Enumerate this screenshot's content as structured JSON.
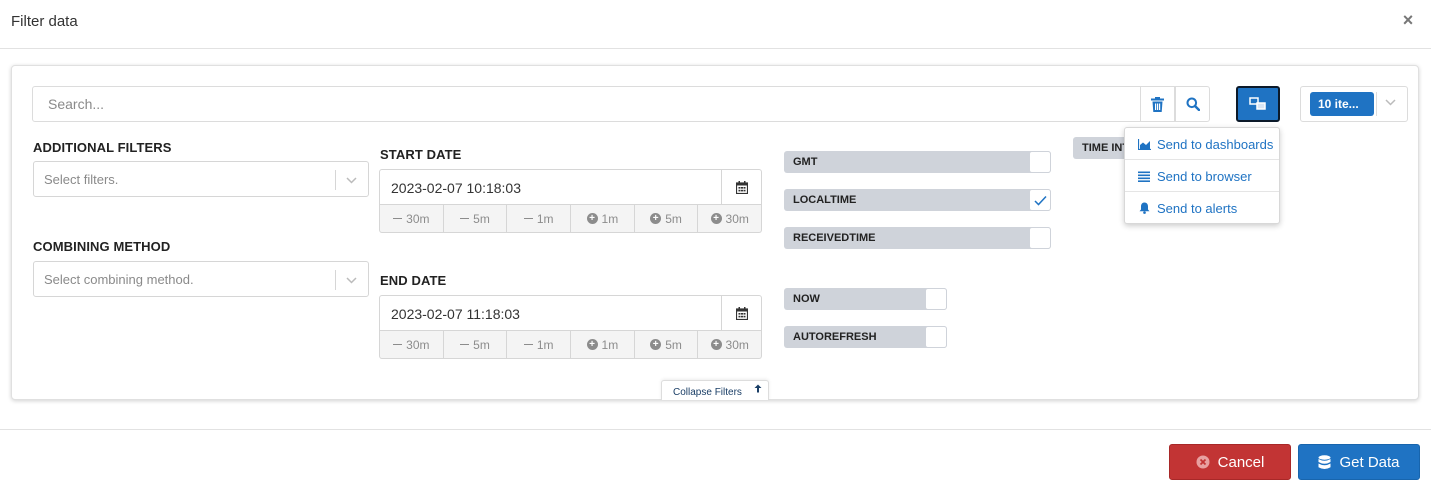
{
  "modal": {
    "title": "Filter data",
    "close_label": "×"
  },
  "search": {
    "placeholder": "Search..."
  },
  "items_select": {
    "value": "10 ite..."
  },
  "additional_filters": {
    "label": "ADDITIONAL FILTERS",
    "placeholder": "Select filters."
  },
  "combining_method": {
    "label": "COMBINING METHOD",
    "placeholder": "Select combining method."
  },
  "start_date": {
    "label": "START DATE",
    "value": "2023-02-07 10:18:03",
    "offsets": [
      "30m",
      "5m",
      "1m",
      "1m",
      "5m",
      "30m"
    ]
  },
  "end_date": {
    "label": "END DATE",
    "value": "2023-02-07 11:18:03",
    "offsets": [
      "30m",
      "5m",
      "1m",
      "1m",
      "5m",
      "30m"
    ]
  },
  "toggles": {
    "gmt": {
      "label": "GMT",
      "checked": false
    },
    "localtime": {
      "label": "LOCALTIME",
      "checked": true
    },
    "receivedtime": {
      "label": "RECEIVEDTIME",
      "checked": false
    },
    "now": {
      "label": "NOW",
      "checked": false
    },
    "autorefresh": {
      "label": "AUTOREFRESH",
      "checked": false
    }
  },
  "time_interval": {
    "label": "TIME INTERVAL"
  },
  "send_menu": {
    "items": [
      {
        "label": "Send to dashboards",
        "icon": "area-chart-icon"
      },
      {
        "label": "Send to browser",
        "icon": "list-icon"
      },
      {
        "label": "Send to alerts",
        "icon": "bell-icon"
      }
    ]
  },
  "collapse": {
    "label": "Collapse Filters"
  },
  "footer": {
    "cancel_label": "Cancel",
    "get_data_label": "Get Data"
  },
  "colors": {
    "primary": "#1f73c3",
    "danger": "#c23434",
    "toggle_bg": "#cfd3da"
  }
}
